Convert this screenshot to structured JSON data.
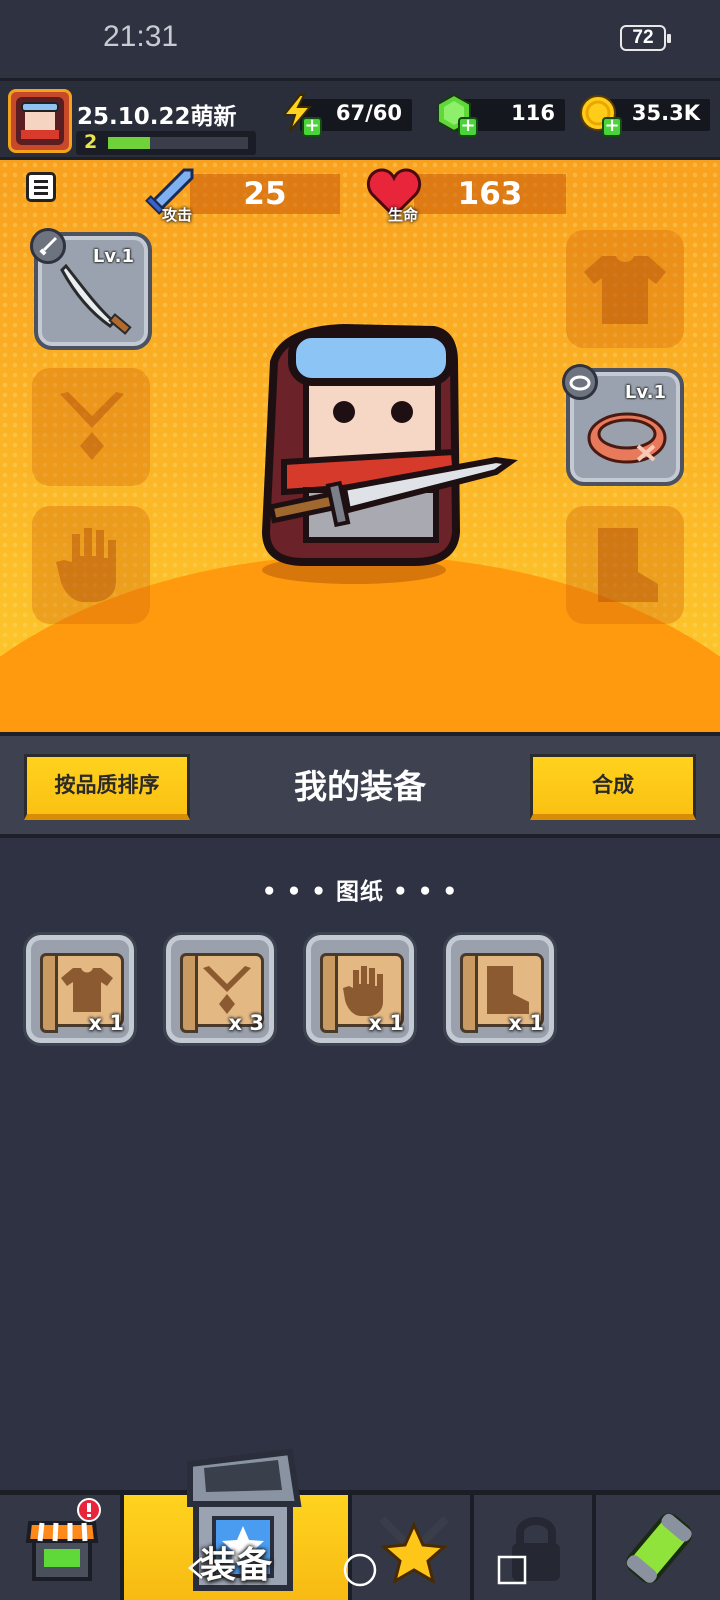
{
  "status_bar": {
    "time": "21:31",
    "battery": "72"
  },
  "player": {
    "name": "25.10.22萌新",
    "level": "2",
    "xp_fraction": 0.3
  },
  "resources": {
    "energy": "67/60",
    "gems": "116",
    "gold": "35.3K"
  },
  "stats": {
    "attack_label": "攻击",
    "attack_value": "25",
    "hp_label": "生命",
    "hp_value": "163"
  },
  "equipment": {
    "weapon_level": "Lv.1",
    "bracelet_level": "Lv.1"
  },
  "toolbar": {
    "sort_button": "按品质排序",
    "title": "我的装备",
    "craft_button": "合成"
  },
  "blueprints": {
    "section_title": "• • •  图纸  • • •",
    "items": [
      {
        "icon": "armor-blueprint-icon",
        "count": "x 1"
      },
      {
        "icon": "necklace-blueprint-icon",
        "count": "x 3"
      },
      {
        "icon": "glove-blueprint-icon",
        "count": "x 1"
      },
      {
        "icon": "boot-blueprint-icon",
        "count": "x 1"
      }
    ]
  },
  "bottom_nav": {
    "active_label": "装备"
  },
  "colors": {
    "accent_yellow": "#fbc112",
    "hero_orange": "#f8a11f",
    "panel_dark": "#2e3242"
  }
}
